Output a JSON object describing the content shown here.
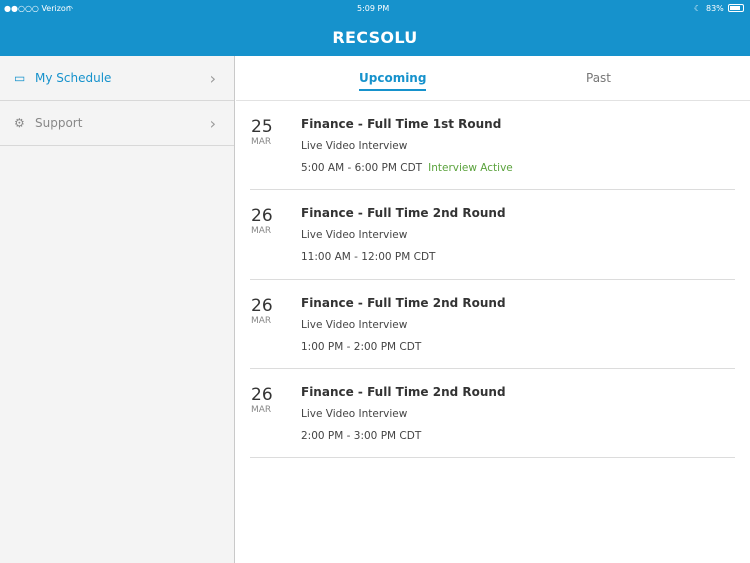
{
  "status_bar": {
    "carrier": "●●○○○ Verizon",
    "wifi": "wifi-icon",
    "time": "5:09 PM",
    "battery": "83%"
  },
  "header": {
    "title": "RECSOLU"
  },
  "sidebar": {
    "items": [
      {
        "label": "My Schedule",
        "icon": "calendar-icon"
      },
      {
        "label": "Support",
        "icon": "gear-icon"
      }
    ]
  },
  "tabs": [
    {
      "label": "Upcoming"
    },
    {
      "label": "Past"
    }
  ],
  "interviews": [
    {
      "day": "25",
      "month": "MAR",
      "title": "Finance - Full Time 1st Round",
      "type": "Live Video Interview",
      "time": "5:00 AM - 6:00 PM CDT",
      "status": "Interview Active"
    },
    {
      "day": "26",
      "month": "MAR",
      "title": "Finance - Full Time 2nd Round",
      "type": "Live Video Interview",
      "time": "11:00 AM - 12:00 PM CDT"
    },
    {
      "day": "26",
      "month": "MAR",
      "title": "Finance - Full Time 2nd Round",
      "type": "Live Video Interview",
      "time": "1:00 PM - 2:00 PM CDT"
    },
    {
      "day": "26",
      "month": "MAR",
      "title": "Finance - Full Time 2nd Round",
      "type": "Live Video Interview",
      "time": "2:00 PM - 3:00 PM CDT"
    }
  ],
  "colors": {
    "brand": "#1692cc",
    "active": "#5aa23c"
  }
}
